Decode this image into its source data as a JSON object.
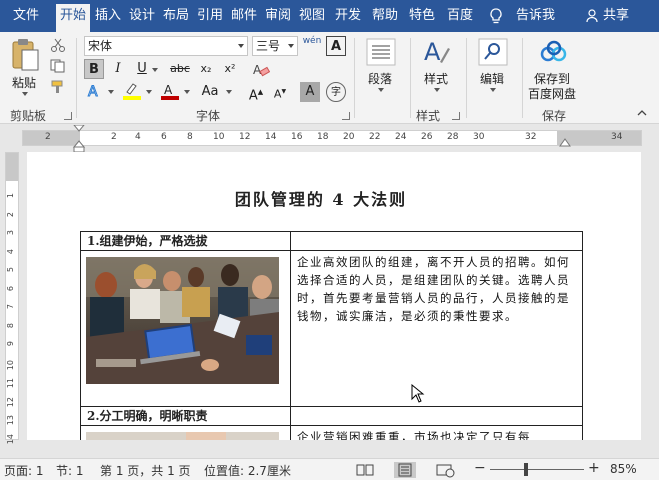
{
  "tabs": [
    "文件",
    "开始",
    "插入",
    "设计",
    "布局",
    "引用",
    "邮件",
    "审阅",
    "视图",
    "开发",
    "帮助",
    "特色",
    "百度"
  ],
  "tell_me": "告诉我",
  "share": "共享",
  "ribbon": {
    "clipboard": {
      "paste": "粘贴",
      "label": "剪贴板"
    },
    "font": {
      "name": "宋体",
      "size": "三号",
      "label": "字体",
      "wen": "wén",
      "bold": "B",
      "italic": "I",
      "underline": "U",
      "strike": "abc",
      "sub": "x₂",
      "sup": "x²",
      "aa": "Aa",
      "grow": "A",
      "shrink": "A",
      "char_a": "A",
      "char_zi": "字"
    },
    "paragraph": {
      "label": "段落"
    },
    "styles": {
      "button": "样式",
      "label": "样式"
    },
    "editing": {
      "button": "编辑"
    },
    "save": {
      "line1": "保存到",
      "line2": "百度网盘",
      "label": "保存"
    }
  },
  "ruler": {
    "ticks": [
      "2",
      "2",
      "4",
      "6",
      "8",
      "10",
      "12",
      "14",
      "16",
      "18",
      "20",
      "22",
      "24",
      "26",
      "28",
      "30",
      "32",
      "34"
    ]
  },
  "vruler": {
    "ticks": [
      "1",
      "2",
      "3",
      "4",
      "5",
      "6",
      "7",
      "8",
      "9",
      "10",
      "11",
      "12",
      "13",
      "14"
    ]
  },
  "document": {
    "title": "团队管理的 4 大法则",
    "rows": [
      {
        "heading": "1.组建伊始，严格选拔",
        "text": "企业高效团队的组建，离不开人员的招聘。如何选择合适的人员，是组建团队的关键。选聘人员时，首先要考量营销人员的品行，人员接触的是钱物，诚实廉洁，是必须的秉性要求。"
      },
      {
        "heading": "2.分工明确，明晰职责",
        "text": "企业营销困难重重，市场也决定了只有每"
      }
    ]
  },
  "status": {
    "page": "页面: 1",
    "section": "节: 1",
    "pages": "第 1 页，共 1 页",
    "position": "位置值: 2.7厘米",
    "zoom": "85%",
    "minus": "−",
    "plus": "+"
  },
  "colors": {
    "brand": "#2b579a",
    "highlight": "#ffff00",
    "font_color": "#c00000"
  }
}
